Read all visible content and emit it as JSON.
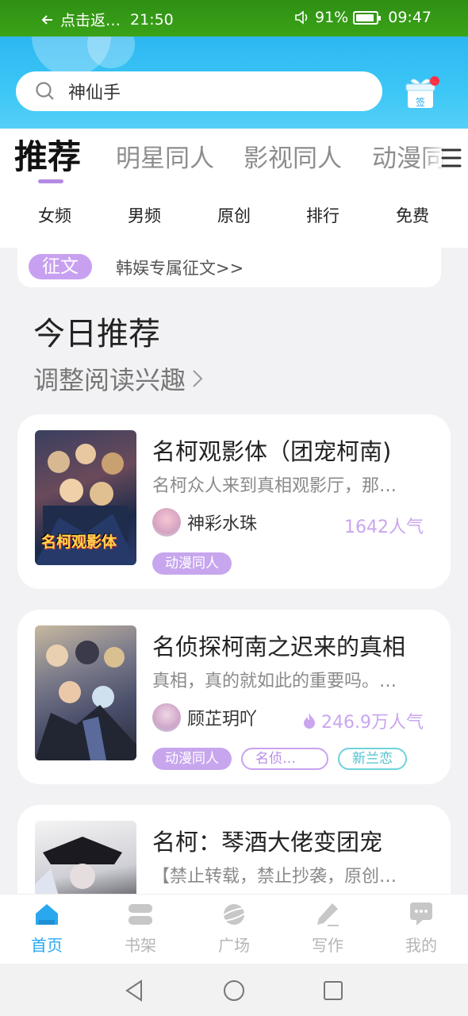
{
  "status_bar": {
    "back_label": "点击返…",
    "back_time": "21:50",
    "battery": "91%",
    "battery_level": 0.91,
    "time": "09:47"
  },
  "search": {
    "placeholder": "神仙手"
  },
  "gift_label": "签",
  "tabs": [
    {
      "label": "推荐",
      "active": true
    },
    {
      "label": "明星同人"
    },
    {
      "label": "影视同人"
    },
    {
      "label": "动漫同人"
    }
  ],
  "categories": [
    "女频",
    "男频",
    "原创",
    "排行",
    "免费"
  ],
  "notice": {
    "badge": "征文",
    "text": "韩娱专属征文>>"
  },
  "section": {
    "title": "今日推荐",
    "subtitle": "调整阅读兴趣"
  },
  "books": [
    {
      "title": "名柯观影体（团宠柯南)",
      "desc": "名柯众人来到真相观影厅，那…",
      "author": "神彩水珠",
      "popularity": "1642人气",
      "hot": false,
      "cover_text": "名柯观影体",
      "tags": [
        "动漫同人"
      ]
    },
    {
      "title": "名侦探柯南之迟来的真相",
      "desc": "真相，真的就如此的重要吗。…",
      "author": "顾芷玥吖",
      "popularity": "246.9万人气",
      "hot": true,
      "tags": [
        "动漫同人",
        "名侦…",
        "新兰恋"
      ]
    },
    {
      "title": "名柯：琴酒大佬变团宠",
      "desc": "【禁止转载，禁止抄袭，原创…"
    }
  ],
  "bottom_nav": [
    {
      "label": "首页",
      "icon": "home-icon",
      "active": true
    },
    {
      "label": "书架",
      "icon": "bookshelf-icon"
    },
    {
      "label": "广场",
      "icon": "planet-icon"
    },
    {
      "label": "写作",
      "icon": "pen-icon"
    },
    {
      "label": "我的",
      "icon": "chat-icon"
    }
  ],
  "colors": {
    "accent": "#2aa8ef",
    "purple": "#c7a6ee",
    "status_bar": "#3aa318"
  }
}
